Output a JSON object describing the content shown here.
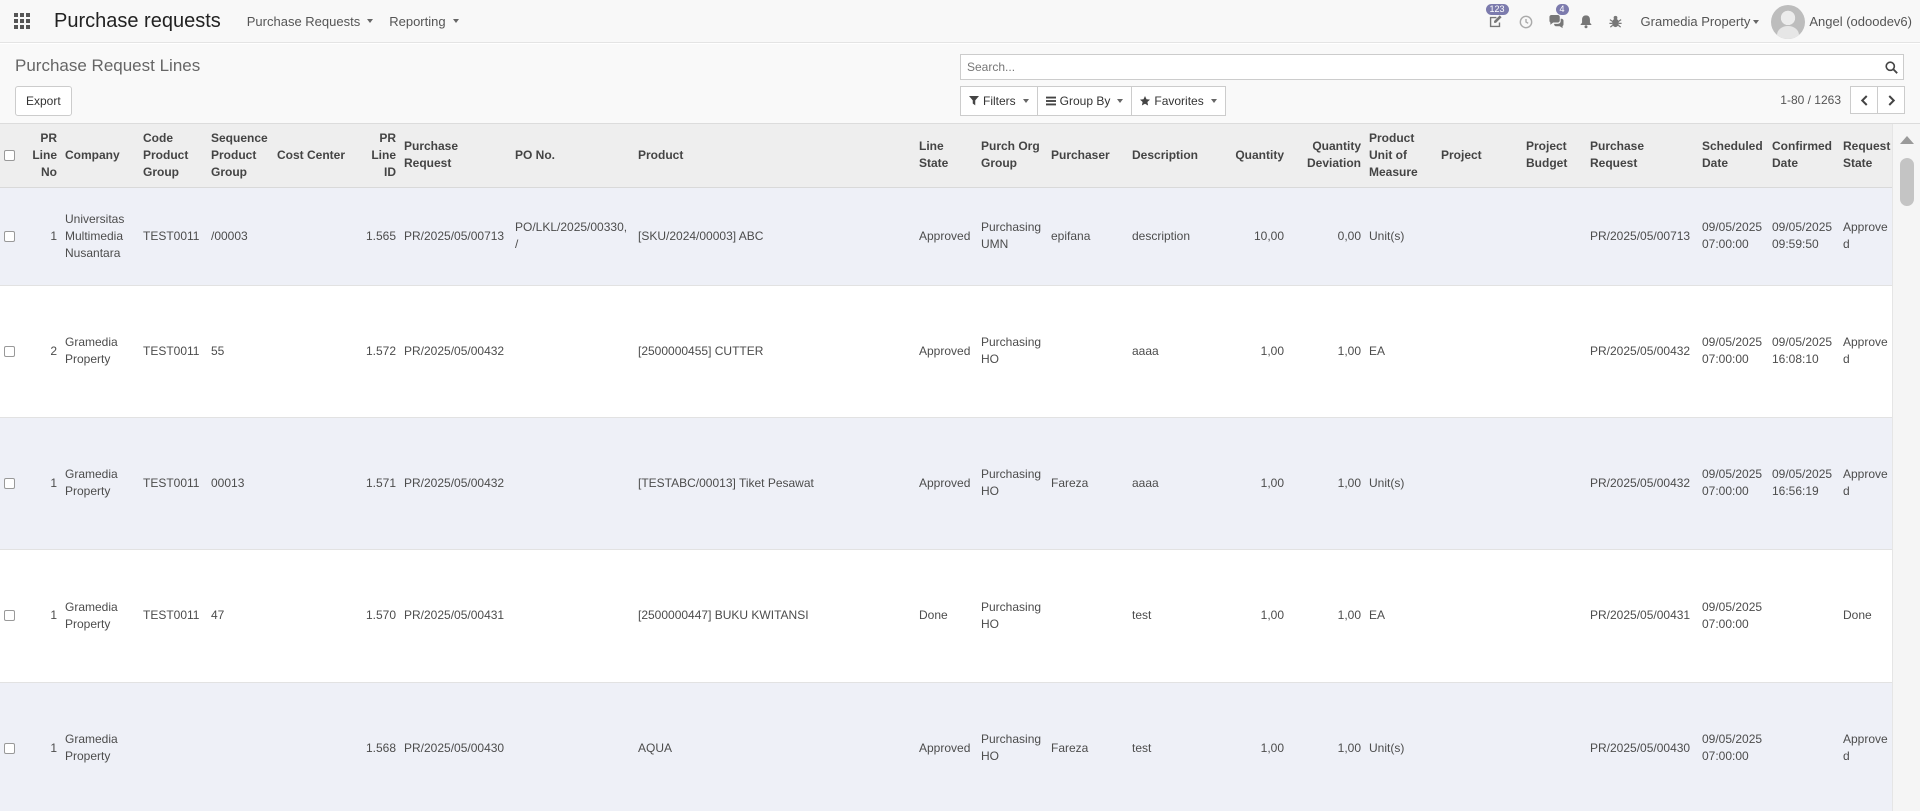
{
  "app": {
    "title": "Purchase requests",
    "menu": [
      {
        "label": "Purchase Requests"
      },
      {
        "label": "Reporting"
      }
    ]
  },
  "systray": {
    "activity_count": "123",
    "message_count": "4",
    "company": "Gramedia Property",
    "user": "Angel (odoodev6)"
  },
  "control": {
    "title": "Purchase Request Lines",
    "export_label": "Export",
    "search_placeholder": "Search...",
    "filters_label": "Filters",
    "groupby_label": "Group By",
    "favorites_label": "Favorites",
    "pager_value": "1-80 / 1263"
  },
  "table": {
    "columns": [
      {
        "label": "",
        "w": 24
      },
      {
        "label": "PR Line No",
        "w": 37,
        "num": true
      },
      {
        "label": "Company",
        "w": 78
      },
      {
        "label": "Code Product Group",
        "w": 68
      },
      {
        "label": "Sequence Product Group",
        "w": 66
      },
      {
        "label": "Cost Center",
        "w": 88
      },
      {
        "label": "PR Line ID",
        "w": 39,
        "num": true
      },
      {
        "label": "Purchase Request",
        "w": 111
      },
      {
        "label": "PO No.",
        "w": 123
      },
      {
        "label": "Product",
        "w": 281
      },
      {
        "label": "Line State",
        "w": 62
      },
      {
        "label": "Purch Org Group",
        "w": 70
      },
      {
        "label": "Purchaser",
        "w": 81
      },
      {
        "label": "Description",
        "w": 89
      },
      {
        "label": "Quantity",
        "w": 71,
        "num": true
      },
      {
        "label": "Quantity Deviation",
        "w": 77,
        "num": true
      },
      {
        "label": "Product Unit of Measure",
        "w": 72
      },
      {
        "label": "Project",
        "w": 85
      },
      {
        "label": "Project Budget",
        "w": 64
      },
      {
        "label": "Purchase Request",
        "w": 112
      },
      {
        "label": "Scheduled Date",
        "w": 70
      },
      {
        "label": "Confirmed Date",
        "w": 71
      },
      {
        "label": "Request State",
        "w": 53
      }
    ],
    "rows": [
      {
        "h": 98,
        "cells": [
          "",
          "1",
          "Universitas Multimedia Nusantara",
          "TEST0011",
          "/00003",
          "",
          "1.565",
          "PR/2025/05/00713",
          "PO/LKL/2025/00330, /",
          "[SKU/2024/00003] ABC",
          "Approved",
          "Purchasing UMN",
          "epifana",
          "description",
          "10,00",
          "0,00",
          "Unit(s)",
          "",
          "",
          "PR/2025/05/00713",
          "09/05/2025 07:00:00",
          "09/05/2025 09:59:50",
          "Approved"
        ]
      },
      {
        "h": 132,
        "cells": [
          "",
          "2",
          "Gramedia Property",
          "TEST0011",
          "55",
          "",
          "1.572",
          "PR/2025/05/00432",
          "",
          "[2500000455] CUTTER",
          "Approved",
          "Purchasing HO",
          "",
          "aaaa",
          "1,00",
          "1,00",
          "EA",
          "",
          "",
          "PR/2025/05/00432",
          "09/05/2025 07:00:00",
          "09/05/2025 16:08:10",
          "Approved"
        ]
      },
      {
        "h": 132,
        "cells": [
          "",
          "1",
          "Gramedia Property",
          "TEST0011",
          "00013",
          "",
          "1.571",
          "PR/2025/05/00432",
          "",
          "[TESTABC/00013] Tiket Pesawat",
          "Approved",
          "Purchasing HO",
          "Fareza",
          "aaaa",
          "1,00",
          "1,00",
          "Unit(s)",
          "",
          "",
          "PR/2025/05/00432",
          "09/05/2025 07:00:00",
          "09/05/2025 16:56:19",
          "Approved"
        ]
      },
      {
        "h": 133,
        "cells": [
          "",
          "1",
          "Gramedia Property",
          "TEST0011",
          "47",
          "",
          "1.570",
          "PR/2025/05/00431",
          "",
          "[2500000447] BUKU KWITANSI",
          "Done",
          "Purchasing HO",
          "",
          "test",
          "1,00",
          "1,00",
          "EA",
          "",
          "",
          "PR/2025/05/00431",
          "09/05/2025 07:00:00",
          "",
          "Done"
        ]
      },
      {
        "h": 132,
        "cells": [
          "",
          "1",
          "Gramedia Property",
          "",
          "",
          "",
          "1.568",
          "PR/2025/05/00430",
          "",
          "AQUA",
          "Approved",
          "Purchasing HO",
          "Fareza",
          "test",
          "1,00",
          "1,00",
          "Unit(s)",
          "",
          "",
          "PR/2025/05/00430",
          "09/05/2025 07:00:00",
          "",
          "Approved"
        ]
      }
    ]
  }
}
